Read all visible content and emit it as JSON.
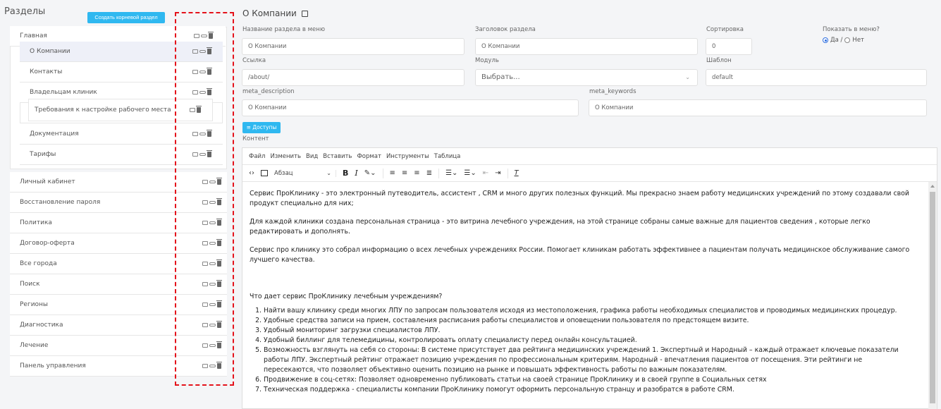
{
  "sidebar": {
    "title": "Разделы",
    "create_root_button": "Создать корневой раздел",
    "items": [
      {
        "label": "Главная"
      },
      {
        "label": "О Компании"
      },
      {
        "label": "Контакты"
      },
      {
        "label": "Владельцам клиник"
      },
      {
        "label": "Требования к настройке рабочего места"
      },
      {
        "label": "Документация"
      },
      {
        "label": "Тарифы"
      },
      {
        "label": "Личный кабинет"
      },
      {
        "label": "Восстановление пароля"
      },
      {
        "label": "Политика"
      },
      {
        "label": "Договор-оферта"
      },
      {
        "label": "Все города"
      },
      {
        "label": "Поиск"
      },
      {
        "label": "Регионы"
      },
      {
        "label": "Диагностика"
      },
      {
        "label": "Лечение"
      },
      {
        "label": "Панель управления"
      }
    ]
  },
  "form": {
    "page_title": "О Компании",
    "menu_name_label": "Название раздела в меню",
    "menu_name_value": "О Компании",
    "heading_label": "Заголовок раздела",
    "heading_value": "О Компании",
    "sort_label": "Сортировка",
    "sort_value": "0",
    "show_menu_label": "Показать в меню?",
    "radio_yes": "Да /",
    "radio_no": "Нет",
    "link_label": "Ссылка",
    "link_value": "/about/",
    "module_label": "Модуль",
    "module_placeholder": "Выбрать...",
    "template_label": "Шаблон",
    "template_value": "default",
    "meta_desc_label": "meta_description",
    "meta_desc_value": "О Компании",
    "meta_kw_label": "meta_keywords",
    "meta_kw_value": "О Компании",
    "access_button": "≡ Доступы",
    "content_label": "Контент"
  },
  "editor": {
    "menu": [
      "Файл",
      "Изменить",
      "Вид",
      "Вставить",
      "Формат",
      "Инструменты",
      "Таблица"
    ],
    "block_format": "Абзац",
    "paragraphs": [
      "Сервис ПроКлинику - это электронный путеводитель, ассистент , CRM и много других полезных функций. Мы прекрасно знаем работу медицинских учреждений по этому создавали свой продукт специально для них;",
      "Для каждой клиники создана персональная страница - это витрина лечебного учреждения, на этой странице собраны самые важные для пациентов сведения , которые легко редактировать и дополнять.",
      "Сервис про клинику это собрал информацию о всех лечебных учреждениях России. Помогает клиникам работать эффективнее а пациентам получать медицинское обслуживание самого лучшего качества."
    ],
    "question": "Что дает сервис ПроКлинику лечебным учреждениям?",
    "list": [
      "Найти вашу клинику среди многих ЛПУ по запросам пользователя исходя из местоположения, графика работы  необходимых специалистов и проводимых медицинских процедур.",
      "Удобные средства записи на прием, составления расписания работы специалистов и оповещении пользователя по предстоящем визите.",
      "Удобный мониторинг загрузки специалистов ЛПУ.",
      "Удобный биллинг для телемедицины, контролировать оплату специалисту перед онлайн консультацией.",
      "Возможность взглянуть на себя со стороны: В системе присутствует два рейтинга  медицинских учреждений 1. Экспертный и Народный – каждый отражает ключевые показатели работы ЛПУ. Экспертный рейтинг отражает позицию учреждения по профессиональным критериям. Народный -  впечатления пациентов от посещения. Эти рейтинги не пересекаются, что позволяет объективно оценить позицию на рынке и повышать эффективность работы по важным показателям.",
      "Продвижение в соц-сетях: Позволяет одновременно публиковать статьи на своей странице ПроКлинику и в своей группе в Социальных сетях",
      "Техническая поддержка - специалисты компании ПроКлинику помогут оформить персональную странцу и разобратся в работе CRM."
    ]
  },
  "colors": {
    "accent": "#2fb8f0",
    "highlight_border": "#e4121b"
  }
}
